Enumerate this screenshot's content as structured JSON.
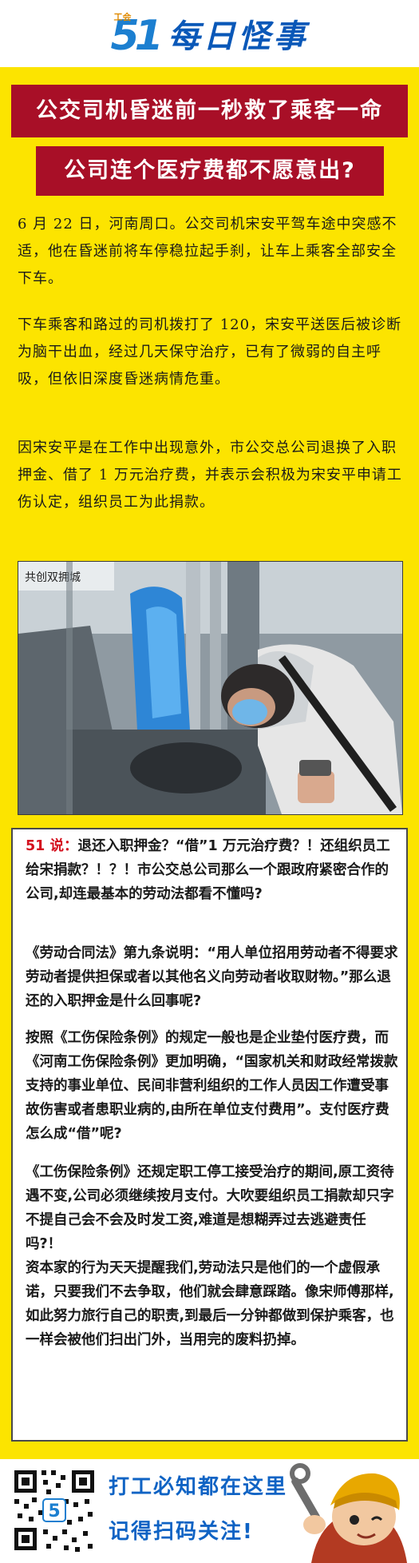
{
  "header": {
    "logo_small": "工会",
    "logo_num": "51",
    "title": "每日怪事"
  },
  "headline": {
    "line1": "公交司机昏迷前一秒救了乘客一命",
    "line2": "公司连个医疗费都不愿意出?"
  },
  "story": {
    "p1": "6 月 22 日，河南周口。公交司机宋安平驾车途中突感不适，他在昏迷前将车停稳拉起手刹，让车上乘客全部安全下车。",
    "p2": "下车乘客和路过的司机拨打了 120，宋安平送医后被诊断为脑干出血，经过几天保守治疗，已有了微弱的自主呼吸，但依旧深度昏迷病情危重。",
    "p3": "因宋安平是在工作中出现意外，市公交总公司退换了入职押金、借了 1 万元治疗费，并表示会积极为宋安平申请工伤认定，组织员工为此捐款。"
  },
  "photo": {
    "sign_text": "共创双拥城"
  },
  "commentary": {
    "lead": "51 说：",
    "c1": "退还入职押金？“借”1 万元治疗费？！还组织员工给宋捐款？！？！市公交总公司那么一个跟政府紧密合作的公司,却连最基本的劳动法都看不懂吗?",
    "c2": "《劳动合同法》第九条说明：“用人单位招用劳动者不得要求劳动者提供担保或者以其他名义向劳动者收取财物。”那么退还的入职押金是什么回事呢?",
    "c3": "按照《工伤保险条例》的规定一般也是企业垫付医疗费，而《河南工伤保险条例》更加明确，“国家机关和财政经常拨款支持的事业单位、民间非营利组织的工作人员因工作遭受事故伤害或者患职业病的,由所在单位支付费用”。支付医疗费怎么成“借”呢?",
    "c4": "《工伤保险条例》还规定职工停工接受治疗的期间,原工资待遇不变,公司必须继续按月支付。大吹要组织员工捐款却只字不提自己会不会及时发工资,难道是想糊弄过去逃避责任吗?！",
    "c5": "资本家的行为天天提醒我们,劳动法只是他们的一个虚假承诺，只要我们不去争取，他们就会肆意踩踏。像宋师傅那样,如此努力旅行自己的职责,到最后一分钟都做到保护乘客，也一样会被他们扫出门外，当用完的废料扔掉。"
  },
  "footer": {
    "line1": "打工必知都在这里",
    "line2": "记得扫码关注!",
    "qr_center": "5"
  },
  "colors": {
    "board": "#fce400",
    "headline": "#a80f27",
    "accent_red": "#d4101e",
    "brand_blue": "#0f63c4"
  }
}
